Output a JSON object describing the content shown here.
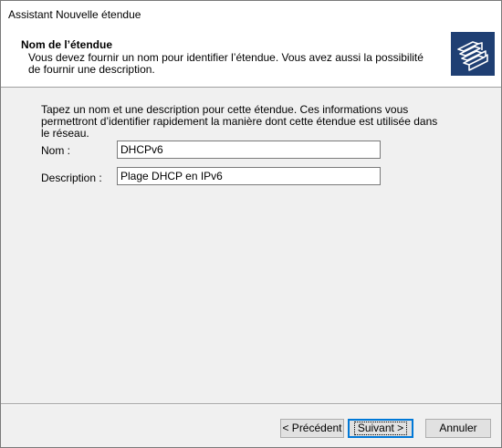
{
  "window": {
    "title": "Assistant Nouvelle étendue"
  },
  "header": {
    "title": "Nom de l’étendue",
    "description": "Vous devez fournir un nom pour identifier l’étendue. Vous avez aussi la possibilité de fournir une description.",
    "icon": "folders-icon"
  },
  "main": {
    "intro": "Tapez un nom et une description pour cette étendue. Ces informations vous permettront d’identifier rapidement la manière dont cette étendue est utilisée dans le réseau.",
    "name_label": "Nom :",
    "name_value": "DHCPv6",
    "description_label": "Description :",
    "description_value": "Plage DHCP en IPv6"
  },
  "buttons": {
    "previous": "< Précédent",
    "next": "Suivant >",
    "cancel": "Annuler"
  },
  "colors": {
    "accent": "#0078d7",
    "face": "#f0f0f0",
    "header_bg": "#ffffff"
  }
}
